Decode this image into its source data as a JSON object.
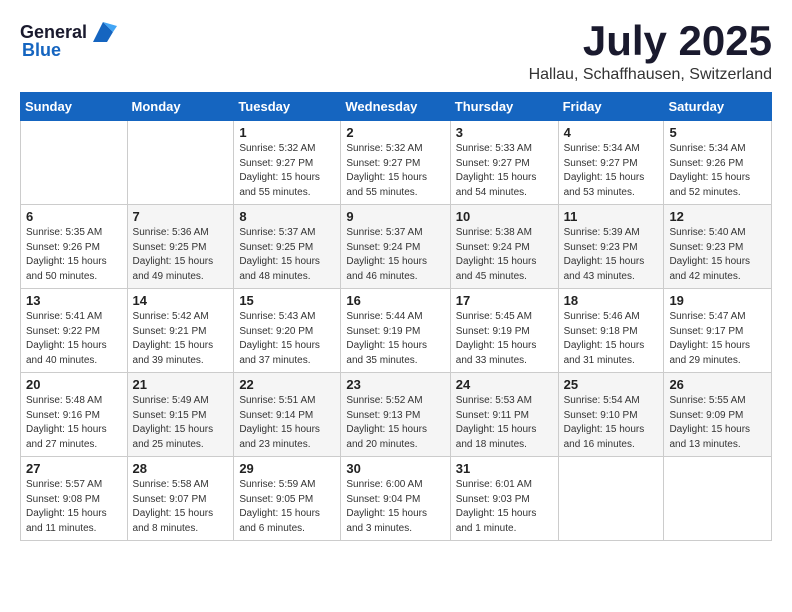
{
  "header": {
    "logo_general": "General",
    "logo_blue": "Blue",
    "title": "July 2025",
    "location": "Hallau, Schaffhausen, Switzerland"
  },
  "weekdays": [
    "Sunday",
    "Monday",
    "Tuesday",
    "Wednesday",
    "Thursday",
    "Friday",
    "Saturday"
  ],
  "weeks": [
    [
      {
        "day": "",
        "info": ""
      },
      {
        "day": "",
        "info": ""
      },
      {
        "day": "1",
        "info": "Sunrise: 5:32 AM\nSunset: 9:27 PM\nDaylight: 15 hours\nand 55 minutes."
      },
      {
        "day": "2",
        "info": "Sunrise: 5:32 AM\nSunset: 9:27 PM\nDaylight: 15 hours\nand 55 minutes."
      },
      {
        "day": "3",
        "info": "Sunrise: 5:33 AM\nSunset: 9:27 PM\nDaylight: 15 hours\nand 54 minutes."
      },
      {
        "day": "4",
        "info": "Sunrise: 5:34 AM\nSunset: 9:27 PM\nDaylight: 15 hours\nand 53 minutes."
      },
      {
        "day": "5",
        "info": "Sunrise: 5:34 AM\nSunset: 9:26 PM\nDaylight: 15 hours\nand 52 minutes."
      }
    ],
    [
      {
        "day": "6",
        "info": "Sunrise: 5:35 AM\nSunset: 9:26 PM\nDaylight: 15 hours\nand 50 minutes."
      },
      {
        "day": "7",
        "info": "Sunrise: 5:36 AM\nSunset: 9:25 PM\nDaylight: 15 hours\nand 49 minutes."
      },
      {
        "day": "8",
        "info": "Sunrise: 5:37 AM\nSunset: 9:25 PM\nDaylight: 15 hours\nand 48 minutes."
      },
      {
        "day": "9",
        "info": "Sunrise: 5:37 AM\nSunset: 9:24 PM\nDaylight: 15 hours\nand 46 minutes."
      },
      {
        "day": "10",
        "info": "Sunrise: 5:38 AM\nSunset: 9:24 PM\nDaylight: 15 hours\nand 45 minutes."
      },
      {
        "day": "11",
        "info": "Sunrise: 5:39 AM\nSunset: 9:23 PM\nDaylight: 15 hours\nand 43 minutes."
      },
      {
        "day": "12",
        "info": "Sunrise: 5:40 AM\nSunset: 9:23 PM\nDaylight: 15 hours\nand 42 minutes."
      }
    ],
    [
      {
        "day": "13",
        "info": "Sunrise: 5:41 AM\nSunset: 9:22 PM\nDaylight: 15 hours\nand 40 minutes."
      },
      {
        "day": "14",
        "info": "Sunrise: 5:42 AM\nSunset: 9:21 PM\nDaylight: 15 hours\nand 39 minutes."
      },
      {
        "day": "15",
        "info": "Sunrise: 5:43 AM\nSunset: 9:20 PM\nDaylight: 15 hours\nand 37 minutes."
      },
      {
        "day": "16",
        "info": "Sunrise: 5:44 AM\nSunset: 9:19 PM\nDaylight: 15 hours\nand 35 minutes."
      },
      {
        "day": "17",
        "info": "Sunrise: 5:45 AM\nSunset: 9:19 PM\nDaylight: 15 hours\nand 33 minutes."
      },
      {
        "day": "18",
        "info": "Sunrise: 5:46 AM\nSunset: 9:18 PM\nDaylight: 15 hours\nand 31 minutes."
      },
      {
        "day": "19",
        "info": "Sunrise: 5:47 AM\nSunset: 9:17 PM\nDaylight: 15 hours\nand 29 minutes."
      }
    ],
    [
      {
        "day": "20",
        "info": "Sunrise: 5:48 AM\nSunset: 9:16 PM\nDaylight: 15 hours\nand 27 minutes."
      },
      {
        "day": "21",
        "info": "Sunrise: 5:49 AM\nSunset: 9:15 PM\nDaylight: 15 hours\nand 25 minutes."
      },
      {
        "day": "22",
        "info": "Sunrise: 5:51 AM\nSunset: 9:14 PM\nDaylight: 15 hours\nand 23 minutes."
      },
      {
        "day": "23",
        "info": "Sunrise: 5:52 AM\nSunset: 9:13 PM\nDaylight: 15 hours\nand 20 minutes."
      },
      {
        "day": "24",
        "info": "Sunrise: 5:53 AM\nSunset: 9:11 PM\nDaylight: 15 hours\nand 18 minutes."
      },
      {
        "day": "25",
        "info": "Sunrise: 5:54 AM\nSunset: 9:10 PM\nDaylight: 15 hours\nand 16 minutes."
      },
      {
        "day": "26",
        "info": "Sunrise: 5:55 AM\nSunset: 9:09 PM\nDaylight: 15 hours\nand 13 minutes."
      }
    ],
    [
      {
        "day": "27",
        "info": "Sunrise: 5:57 AM\nSunset: 9:08 PM\nDaylight: 15 hours\nand 11 minutes."
      },
      {
        "day": "28",
        "info": "Sunrise: 5:58 AM\nSunset: 9:07 PM\nDaylight: 15 hours\nand 8 minutes."
      },
      {
        "day": "29",
        "info": "Sunrise: 5:59 AM\nSunset: 9:05 PM\nDaylight: 15 hours\nand 6 minutes."
      },
      {
        "day": "30",
        "info": "Sunrise: 6:00 AM\nSunset: 9:04 PM\nDaylight: 15 hours\nand 3 minutes."
      },
      {
        "day": "31",
        "info": "Sunrise: 6:01 AM\nSunset: 9:03 PM\nDaylight: 15 hours\nand 1 minute."
      },
      {
        "day": "",
        "info": ""
      },
      {
        "day": "",
        "info": ""
      }
    ]
  ]
}
